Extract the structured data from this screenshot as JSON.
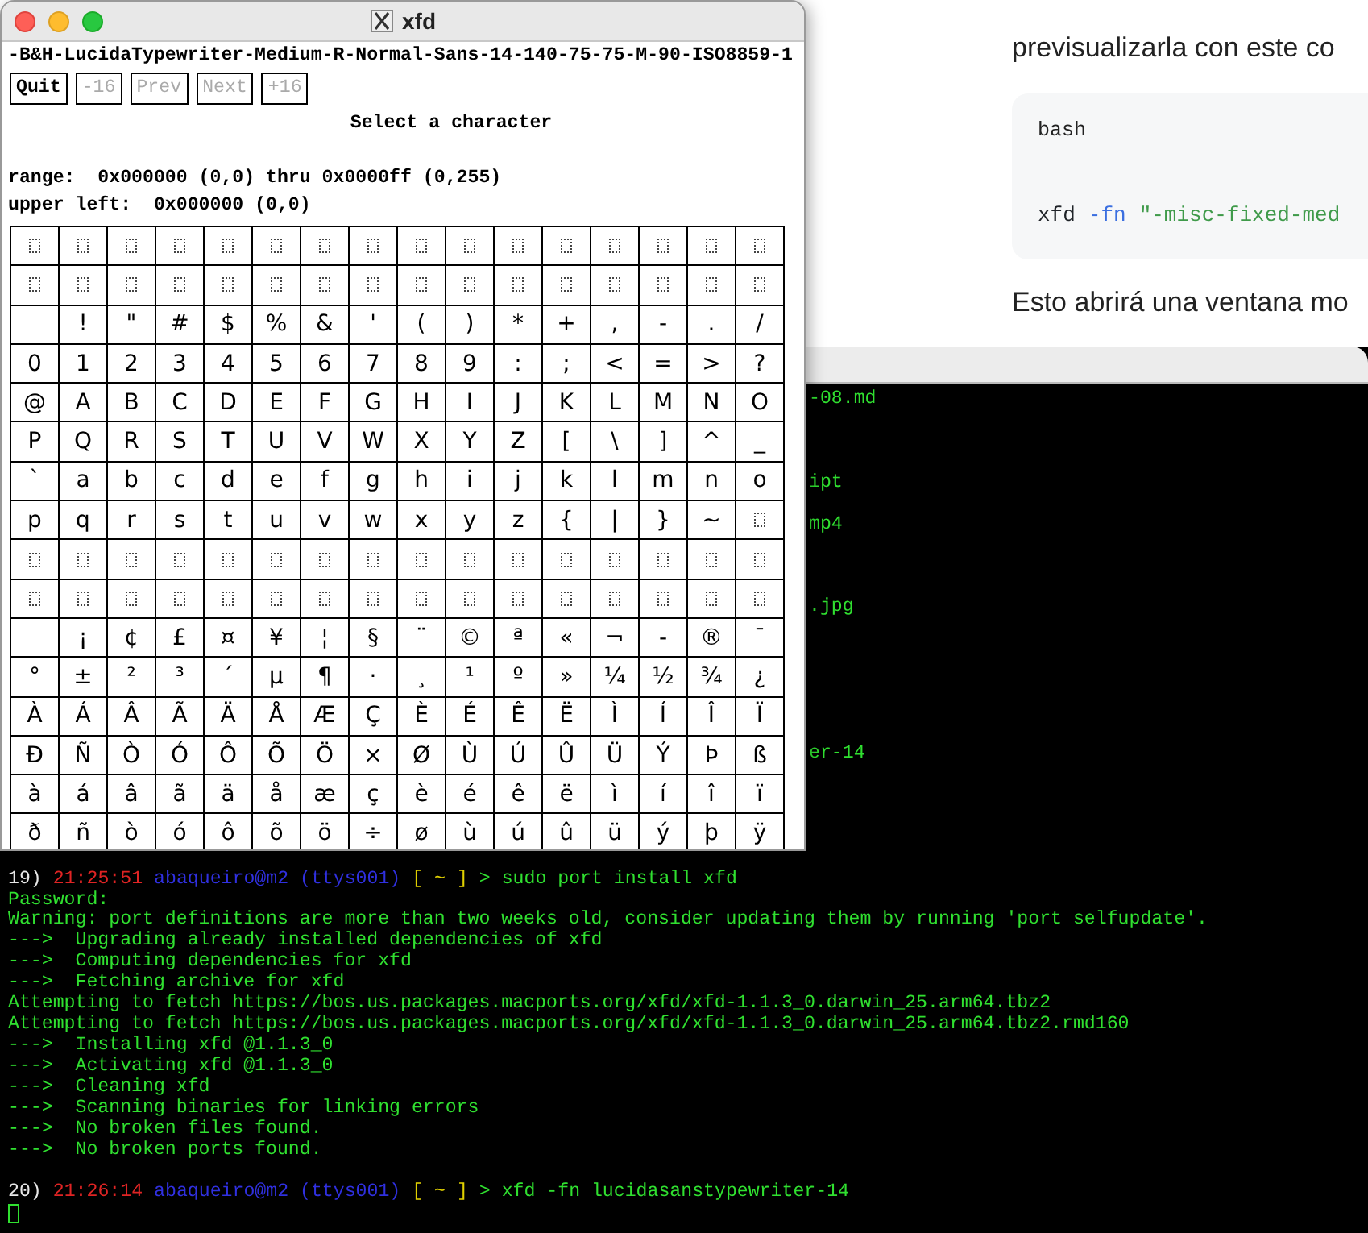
{
  "web_page": {
    "paragraph": "previsualizarla con este co",
    "code_block": {
      "language": "bash",
      "segments": [
        {
          "text": "xfd",
          "color": "#1f2328"
        },
        {
          "text": "-fn",
          "color": "#3b6fe0"
        },
        {
          "text": "\"-misc-fixed-med",
          "color": "#3f9a4a"
        }
      ]
    },
    "paragraph_2": "Esto abrirá una ventana mo"
  },
  "terminal": {
    "lines": [
      {
        "kind": "covered",
        "text": "-08.md"
      },
      {
        "kind": "blank"
      },
      {
        "kind": "blank"
      },
      {
        "kind": "blank"
      },
      {
        "kind": "covered",
        "text": "ipt"
      },
      {
        "kind": "blank"
      },
      {
        "kind": "covered",
        "text": "mp4"
      },
      {
        "kind": "blank"
      },
      {
        "kind": "blank"
      },
      {
        "kind": "blank"
      },
      {
        "kind": "covered",
        "text": ".jpg"
      },
      {
        "kind": "blank"
      },
      {
        "kind": "blank"
      },
      {
        "kind": "blank"
      },
      {
        "kind": "blank"
      },
      {
        "kind": "blank"
      },
      {
        "kind": "blank"
      },
      {
        "kind": "covered",
        "text": "er-14"
      },
      {
        "kind": "blank"
      },
      {
        "kind": "blank"
      },
      {
        "kind": "blank"
      },
      {
        "kind": "blank"
      },
      {
        "kind": "blank"
      },
      {
        "kind": "prompt",
        "segments": [
          {
            "text": "19)",
            "color": "#e8e8e8"
          },
          {
            "text": "21:25:51",
            "color": "#e02424"
          },
          {
            "text": "abaqueiro@m2 (ttys001)",
            "color": "#3030e0"
          },
          {
            "text": "[ ~ ]",
            "color": "#e0d000"
          },
          {
            "text": "> sudo port install xfd",
            "color": "#30e030"
          }
        ]
      },
      {
        "kind": "text",
        "text": "Password:"
      },
      {
        "kind": "text",
        "text": "Warning: port definitions are more than two weeks old, consider updating them by running 'port selfupdate'."
      },
      {
        "kind": "text",
        "text": "--->  Upgrading already installed dependencies of xfd"
      },
      {
        "kind": "text",
        "text": "--->  Computing dependencies for xfd"
      },
      {
        "kind": "text",
        "text": "--->  Fetching archive for xfd"
      },
      {
        "kind": "text",
        "text": "Attempting to fetch https://bos.us.packages.macports.org/xfd/xfd-1.1.3_0.darwin_25.arm64.tbz2"
      },
      {
        "kind": "text",
        "text": "Attempting to fetch https://bos.us.packages.macports.org/xfd/xfd-1.1.3_0.darwin_25.arm64.tbz2.rmd160"
      },
      {
        "kind": "text",
        "text": "--->  Installing xfd @1.1.3_0"
      },
      {
        "kind": "text",
        "text": "--->  Activating xfd @1.1.3_0"
      },
      {
        "kind": "text",
        "text": "--->  Cleaning xfd"
      },
      {
        "kind": "text",
        "text": "--->  Scanning binaries for linking errors"
      },
      {
        "kind": "text",
        "text": "--->  No broken files found."
      },
      {
        "kind": "text",
        "text": "--->  No broken ports found."
      },
      {
        "kind": "blank"
      },
      {
        "kind": "prompt",
        "segments": [
          {
            "text": "20)",
            "color": "#e8e8e8"
          },
          {
            "text": "21:26:14",
            "color": "#e02424"
          },
          {
            "text": "abaqueiro@m2 (ttys001)",
            "color": "#3030e0"
          },
          {
            "text": "[ ~ ]",
            "color": "#e0d000"
          },
          {
            "text": "> xfd -fn lucidasanstypewriter-14",
            "color": "#30e030"
          }
        ]
      },
      {
        "kind": "cursor"
      }
    ]
  },
  "xfd_window": {
    "title": "xfd",
    "font_name": "-B&H-LucidaTypewriter-Medium-R-Normal-Sans-14-140-75-75-M-90-ISO8859-1",
    "buttons": [
      {
        "label": "Quit",
        "disabled": false
      },
      {
        "label": "-16",
        "disabled": true
      },
      {
        "label": "Prev",
        "disabled": true
      },
      {
        "label": "Next",
        "disabled": true
      },
      {
        "label": "+16",
        "disabled": true
      }
    ],
    "status": "Select a character",
    "range": "range:  0x000000 (0,0) thru 0x0000ff (0,255)",
    "upper_left": "upper left:  0x000000 (0,0)",
    "grid": [
      {
        "kind": "missing"
      },
      {
        "kind": "missing"
      },
      {
        "kind": "chars",
        "cells": [
          " ",
          "!",
          "\"",
          "#",
          "$",
          "%",
          "&",
          "'",
          "(",
          ")",
          "*",
          "+",
          ",",
          "-",
          ".",
          "/"
        ]
      },
      {
        "kind": "chars",
        "cells": [
          "0",
          "1",
          "2",
          "3",
          "4",
          "5",
          "6",
          "7",
          "8",
          "9",
          ":",
          ";",
          "<",
          "=",
          ">",
          "?"
        ]
      },
      {
        "kind": "chars",
        "cells": [
          "@",
          "A",
          "B",
          "C",
          "D",
          "E",
          "F",
          "G",
          "H",
          "I",
          "J",
          "K",
          "L",
          "M",
          "N",
          "O"
        ]
      },
      {
        "kind": "chars",
        "cells": [
          "P",
          "Q",
          "R",
          "S",
          "T",
          "U",
          "V",
          "W",
          "X",
          "Y",
          "Z",
          "[",
          "\\",
          "]",
          "^",
          "_"
        ]
      },
      {
        "kind": "chars",
        "cells": [
          "`",
          "a",
          "b",
          "c",
          "d",
          "e",
          "f",
          "g",
          "h",
          "i",
          "j",
          "k",
          "l",
          "m",
          "n",
          "o"
        ]
      },
      {
        "kind": "chars_last_missing",
        "cells": [
          "p",
          "q",
          "r",
          "s",
          "t",
          "u",
          "v",
          "w",
          "x",
          "y",
          "z",
          "{",
          "|",
          "}",
          "~"
        ]
      },
      {
        "kind": "missing"
      },
      {
        "kind": "missing"
      },
      {
        "kind": "chars",
        "cells": [
          " ",
          "¡",
          "¢",
          "£",
          "¤",
          "¥",
          "¦",
          "§",
          "¨",
          "©",
          "ª",
          "«",
          "¬",
          "-",
          "®",
          "¯"
        ]
      },
      {
        "kind": "chars",
        "cells": [
          "°",
          "±",
          "²",
          "³",
          "´",
          "µ",
          "¶",
          "·",
          "¸",
          "¹",
          "º",
          "»",
          "¼",
          "½",
          "¾",
          "¿"
        ]
      },
      {
        "kind": "chars",
        "cells": [
          "À",
          "Á",
          "Â",
          "Ã",
          "Ä",
          "Å",
          "Æ",
          "Ç",
          "È",
          "É",
          "Ê",
          "Ë",
          "Ì",
          "Í",
          "Î",
          "Ï"
        ]
      },
      {
        "kind": "chars",
        "cells": [
          "Ð",
          "Ñ",
          "Ò",
          "Ó",
          "Ô",
          "Õ",
          "Ö",
          "×",
          "Ø",
          "Ù",
          "Ú",
          "Û",
          "Ü",
          "Ý",
          "Þ",
          "ß"
        ]
      },
      {
        "kind": "chars",
        "cells": [
          "à",
          "á",
          "â",
          "ã",
          "ä",
          "å",
          "æ",
          "ç",
          "è",
          "é",
          "ê",
          "ë",
          "ì",
          "í",
          "î",
          "ï"
        ]
      },
      {
        "kind": "chars",
        "cells": [
          "ð",
          "ñ",
          "ò",
          "ó",
          "ô",
          "õ",
          "ö",
          "÷",
          "ø",
          "ù",
          "ú",
          "û",
          "ü",
          "ý",
          "þ",
          "ÿ"
        ]
      }
    ]
  }
}
